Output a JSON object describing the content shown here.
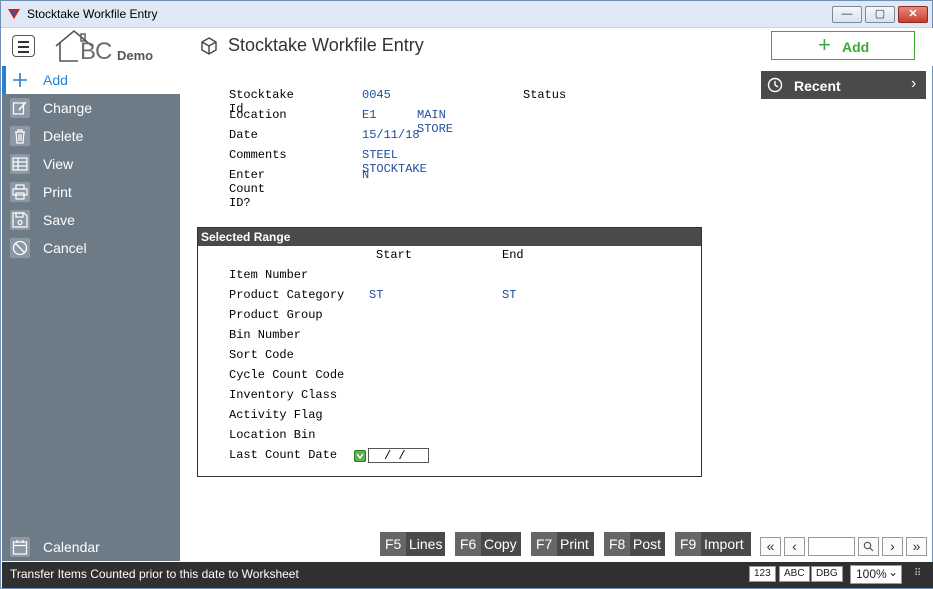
{
  "window": {
    "title": "Stocktake Workfile Entry",
    "min_glyph": "—",
    "max_glyph": "▢",
    "close_glyph": "✕"
  },
  "header": {
    "logo_text": "BC",
    "logo_sub": "Demo",
    "page_title": "Stocktake Workfile Entry",
    "add_button": {
      "icon": "+",
      "label": "Add"
    },
    "accent_color": "#3aaa35"
  },
  "sidebar": {
    "items": [
      {
        "label": "Add",
        "icon": "plus-icon",
        "active": true
      },
      {
        "label": "Change",
        "icon": "edit-icon"
      },
      {
        "label": "Delete",
        "icon": "trash-icon"
      },
      {
        "label": "View",
        "icon": "table-icon"
      },
      {
        "label": "Print",
        "icon": "printer-icon"
      },
      {
        "label": "Save",
        "icon": "save-icon"
      },
      {
        "label": "Cancel",
        "icon": "cancel-icon"
      }
    ],
    "bottom_item": {
      "label": "Calendar",
      "icon": "calendar-icon"
    }
  },
  "form": {
    "stocktake_id": {
      "label": "Stocktake Id",
      "value": "0045"
    },
    "status": {
      "label": "Status",
      "value": ""
    },
    "location": {
      "label": "Location",
      "code": "E1",
      "name": "MAIN STORE"
    },
    "date": {
      "label": "Date",
      "value": "15/11/18"
    },
    "comments": {
      "label": "Comments",
      "value": "STEEL STOCKTAKE"
    },
    "enter_count_id": {
      "label": "Enter Count ID?",
      "value": "N"
    }
  },
  "range": {
    "title": "Selected Range",
    "start_header": "Start",
    "end_header": "End",
    "rows": [
      {
        "label": "Item Number",
        "start": "",
        "end": ""
      },
      {
        "label": "Product Category",
        "start": "ST",
        "end": "ST"
      },
      {
        "label": "Product Group",
        "start": "",
        "end": ""
      },
      {
        "label": "Bin Number",
        "start": "",
        "end": ""
      },
      {
        "label": "Sort Code",
        "start": "",
        "end": ""
      },
      {
        "label": "Cycle Count Code",
        "start": "",
        "end": ""
      },
      {
        "label": "Inventory Class",
        "start": "",
        "end": ""
      },
      {
        "label": "Activity Flag",
        "start": "",
        "end": ""
      },
      {
        "label": "Location Bin",
        "start": "",
        "end": ""
      },
      {
        "label": "Last Count Date",
        "start": "",
        "end": ""
      }
    ],
    "last_count_date_value": " /  /"
  },
  "recent": {
    "label": "Recent",
    "chevron": "›"
  },
  "function_keys": [
    {
      "key": "F5",
      "label": "Lines"
    },
    {
      "key": "F6",
      "label": "Copy"
    },
    {
      "key": "F7",
      "label": "Print"
    },
    {
      "key": "F8",
      "label": "Post"
    },
    {
      "key": "F9",
      "label": "Import"
    }
  ],
  "pager": {
    "first": "«",
    "prev": "‹",
    "next": "›",
    "last": "»",
    "page_value": ""
  },
  "statusbar": {
    "message": "Transfer Items Counted prior to this date to Worksheet",
    "badges": [
      "123",
      "ABC",
      "DBG"
    ],
    "zoom": "100%",
    "zoom_chevron": "⌄",
    "grip": "⠿"
  }
}
